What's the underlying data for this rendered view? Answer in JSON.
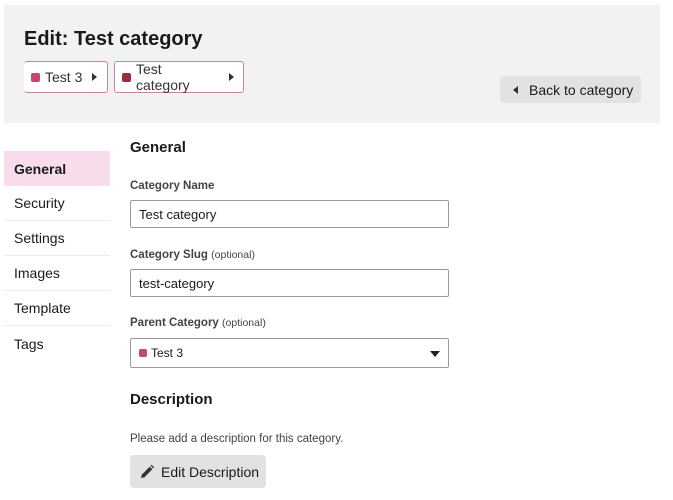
{
  "header": {
    "title": "Edit: Test category",
    "breadcrumbs": [
      {
        "label": "Test 3",
        "color": "#c4457a"
      },
      {
        "label": "Test category",
        "color": "#9b2d3e"
      }
    ],
    "back_label": "Back to category"
  },
  "sidebar": {
    "items": [
      {
        "label": "General",
        "active": true
      },
      {
        "label": "Security"
      },
      {
        "label": "Settings"
      },
      {
        "label": "Images"
      },
      {
        "label": "Template"
      },
      {
        "label": "Tags"
      }
    ]
  },
  "general": {
    "title": "General",
    "name_label": "Category Name",
    "name_value": "Test category",
    "slug_label": "Category Slug",
    "slug_optional": "(optional)",
    "slug_value": "test-category",
    "parent_label": "Parent Category",
    "parent_optional": "(optional)",
    "parent_value": "Test 3",
    "parent_color": "#c4457a"
  },
  "description": {
    "title": "Description",
    "help_text": "Please add a description for this category.",
    "edit_label": "Edit Description"
  }
}
